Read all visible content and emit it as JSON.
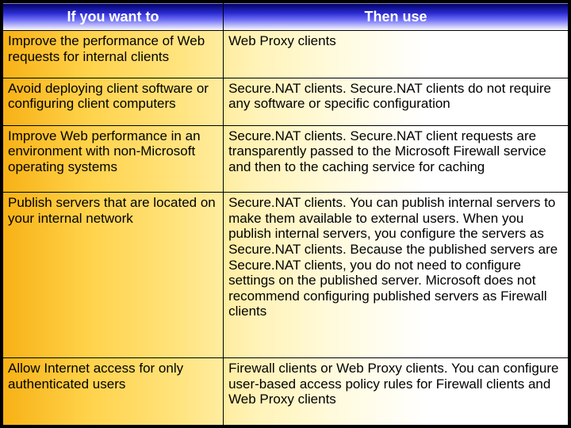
{
  "header": {
    "left": "If you want to",
    "right": "Then use"
  },
  "rows": [
    {
      "want": "Improve the performance of Web requests for internal clients",
      "use": "Web Proxy clients"
    },
    {
      "want": "Avoid deploying client software or configuring client computers",
      "use": "Secure.NAT clients. Secure.NAT clients do not require any software or specific configuration"
    },
    {
      "want": "Improve Web performance in an environment with non-Microsoft operating systems",
      "use": "Secure.NAT clients. Secure.NAT client requests are transparently passed to the Microsoft Firewall service and then to the caching service for caching"
    },
    {
      "want": "Publish servers that are located on your internal network",
      "use": "Secure.NAT clients. You can publish internal servers to make them available to external users. When you publish internal servers, you configure the servers as Secure.NAT clients. Because the published servers are Secure.NAT clients, you do not need to configure settings on the published server. Microsoft does not recommend configuring published servers as Firewall clients"
    },
    {
      "want": "Allow Internet access for only authenticated users",
      "use": "Firewall clients or Web Proxy clients. You can configure user-based access policy rules for Firewall clients and Web Proxy clients"
    }
  ]
}
